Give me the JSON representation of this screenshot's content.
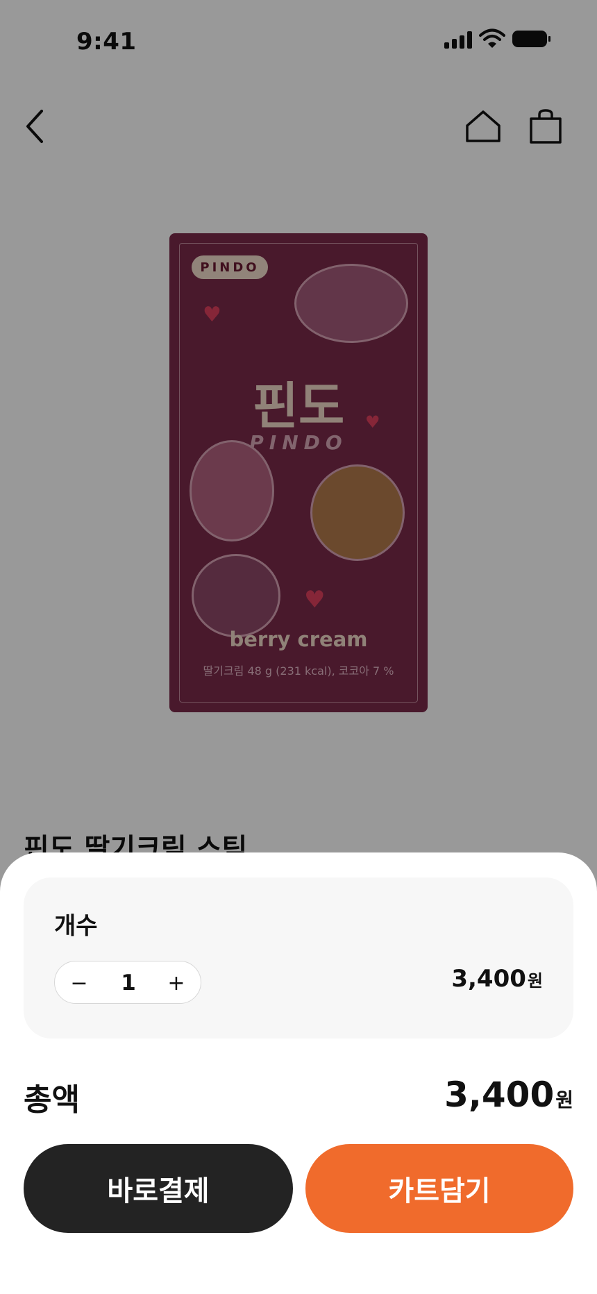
{
  "status_bar": {
    "time": "9:41"
  },
  "product": {
    "name": "핀도 딸기크림 스틱",
    "package": {
      "brand_badge": "PINDO",
      "title_ko": "핀도",
      "title_en": "PINDO",
      "flavor": "berry cream",
      "info": "딸기크림 48 g (231 kcal), 코코아 7 %"
    }
  },
  "sheet": {
    "quantity_label": "개수",
    "minus_symbol": "−",
    "plus_symbol": "+",
    "quantity_value": "1",
    "unit_price": "3,400",
    "currency": "원",
    "total_label": "총액",
    "total_price": "3,400",
    "buy_now_label": "바로결제",
    "add_to_cart_label": "카트담기"
  },
  "colors": {
    "accent": "#f06b2c",
    "dark_button": "#232323",
    "package": "#7a2a4a"
  }
}
